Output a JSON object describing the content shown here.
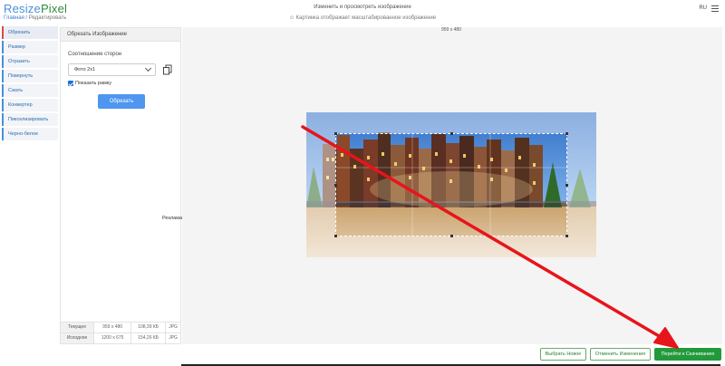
{
  "header": {
    "logo_part1": "Resize",
    "logo_part2": "Pixel",
    "breadcrumb_home": "Главная",
    "breadcrumb_sep": " / ",
    "breadcrumb_current": "Редактировать",
    "title": "Изменить и просмотреть изображение",
    "subtitle": "☺ Картинка отображает масштабированное изображение",
    "language": "RU"
  },
  "tools": [
    {
      "label": "Обрезать",
      "active": true
    },
    {
      "label": "Размер",
      "active": false
    },
    {
      "label": "Отразить",
      "active": false
    },
    {
      "label": "Повернуть",
      "active": false
    },
    {
      "label": "Сжать",
      "active": false
    },
    {
      "label": "Конвертер",
      "active": false
    },
    {
      "label": "Пикселизировать",
      "active": false
    },
    {
      "label": "Черно-белое",
      "active": false
    }
  ],
  "panel": {
    "title": "Обрезать Изображение",
    "ratio_label": "Соотношение сторон",
    "ratio_value": "Фото 2x1",
    "show_frame_label": "Показать рамку",
    "show_frame_checked": true,
    "crop_button": "Обрезать",
    "ad_label": "Реклама"
  },
  "info": {
    "rows": [
      {
        "label": "Текущее",
        "dims": "959 x 480",
        "size": "108,39 КБ",
        "format": "JPG"
      },
      {
        "label": "Исходное",
        "dims": "1200 x 675",
        "size": "154,26 КБ",
        "format": "JPG"
      }
    ]
  },
  "canvas": {
    "dimensions_label": "959 x 480"
  },
  "bottom": {
    "choose_new": "Выбрать Новое",
    "undo_changes": "Отменить Изменения",
    "download": "Перейти к Скачиванию"
  },
  "colors": {
    "accent": "#4a90d9",
    "active_tool": "#e04848",
    "primary_button": "#229a3c",
    "arrow": "#e8141b"
  }
}
